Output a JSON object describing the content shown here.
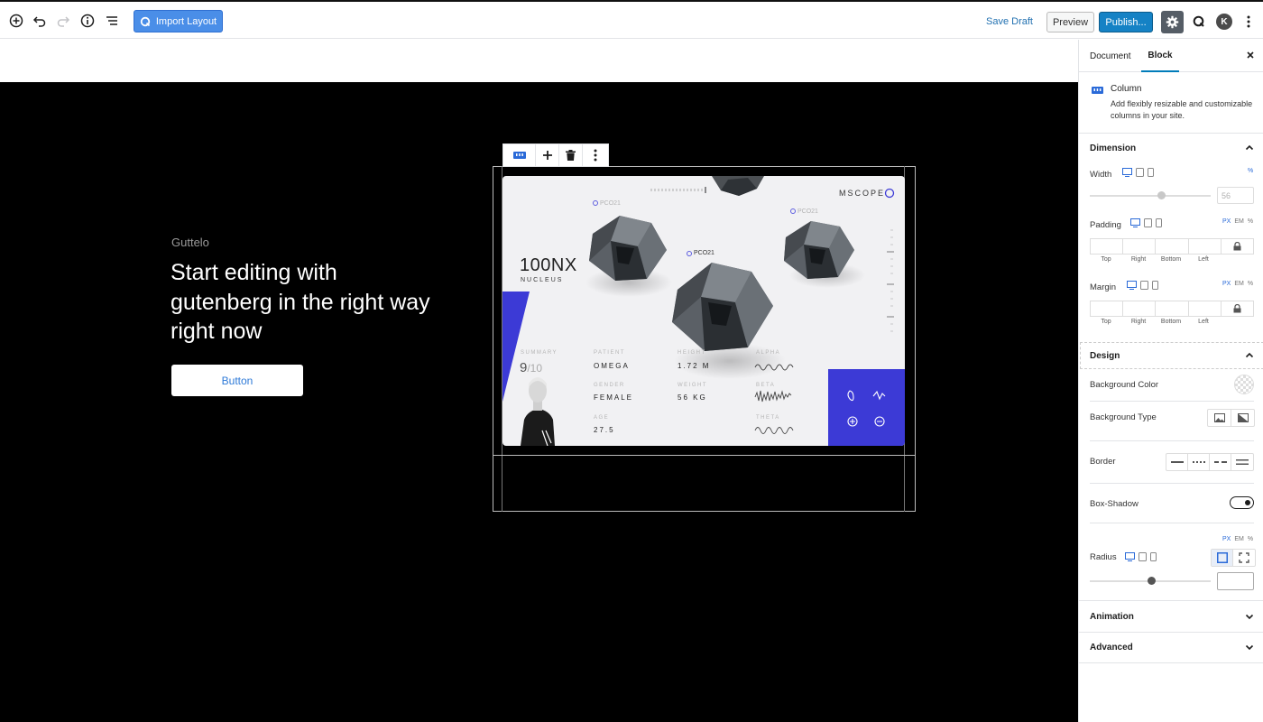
{
  "toolbar": {
    "import_label": "Import Layout",
    "save_draft_label": "Save Draft",
    "preview_label": "Preview",
    "publish_label": "Publish...",
    "avatar_initial": "K"
  },
  "hero": {
    "kicker": "Guttelo",
    "title": "Start editing with gutenberg in the right way right now",
    "button_label": "Button"
  },
  "mockup": {
    "brand": "MSCOPE",
    "headline": "100NX",
    "subline": "NUCLEUS",
    "tags": [
      "PCO21",
      "PCO21",
      "PCO21"
    ],
    "summary_label": "SUMMARY",
    "summary_value": "9",
    "summary_total": "/10",
    "fields": [
      {
        "label": "PATIENT",
        "value": "OMEGA"
      },
      {
        "label": "HEIGHT",
        "value": "1.72 M"
      },
      {
        "label": "ALPHA",
        "value": ""
      },
      {
        "label": "GENDER",
        "value": "FEMALE"
      },
      {
        "label": "WEIGHT",
        "value": "56 KG"
      },
      {
        "label": "BETA",
        "value": ""
      },
      {
        "label": "AGE",
        "value": "27.5"
      },
      {
        "label": "THETA",
        "value": ""
      }
    ]
  },
  "sidebar": {
    "tabs": [
      "Document",
      "Block"
    ],
    "active_tab": "Block",
    "block_name": "Column",
    "block_description": "Add flexibly resizable and customizable columns in your site.",
    "dimension": {
      "title": "Dimension",
      "width_label": "Width",
      "width_unit": "%",
      "width_value": "56",
      "padding_label": "Padding",
      "margin_label": "Margin",
      "units": [
        "PX",
        "EM",
        "%"
      ],
      "sides": [
        "Top",
        "Right",
        "Bottom",
        "Left"
      ]
    },
    "design": {
      "title": "Design",
      "background_color_label": "Background Color",
      "background_type_label": "Background Type",
      "border_label": "Border",
      "box_shadow_label": "Box-Shadow",
      "radius_label": "Radius",
      "units": [
        "PX",
        "EM",
        "%"
      ]
    },
    "animation_title": "Animation",
    "advanced_title": "Advanced"
  },
  "colors": {
    "accent": "#007cba",
    "import_button": "#4a8ee8",
    "publish_button": "#1582c5",
    "mock_blue": "#3c3ad6"
  }
}
